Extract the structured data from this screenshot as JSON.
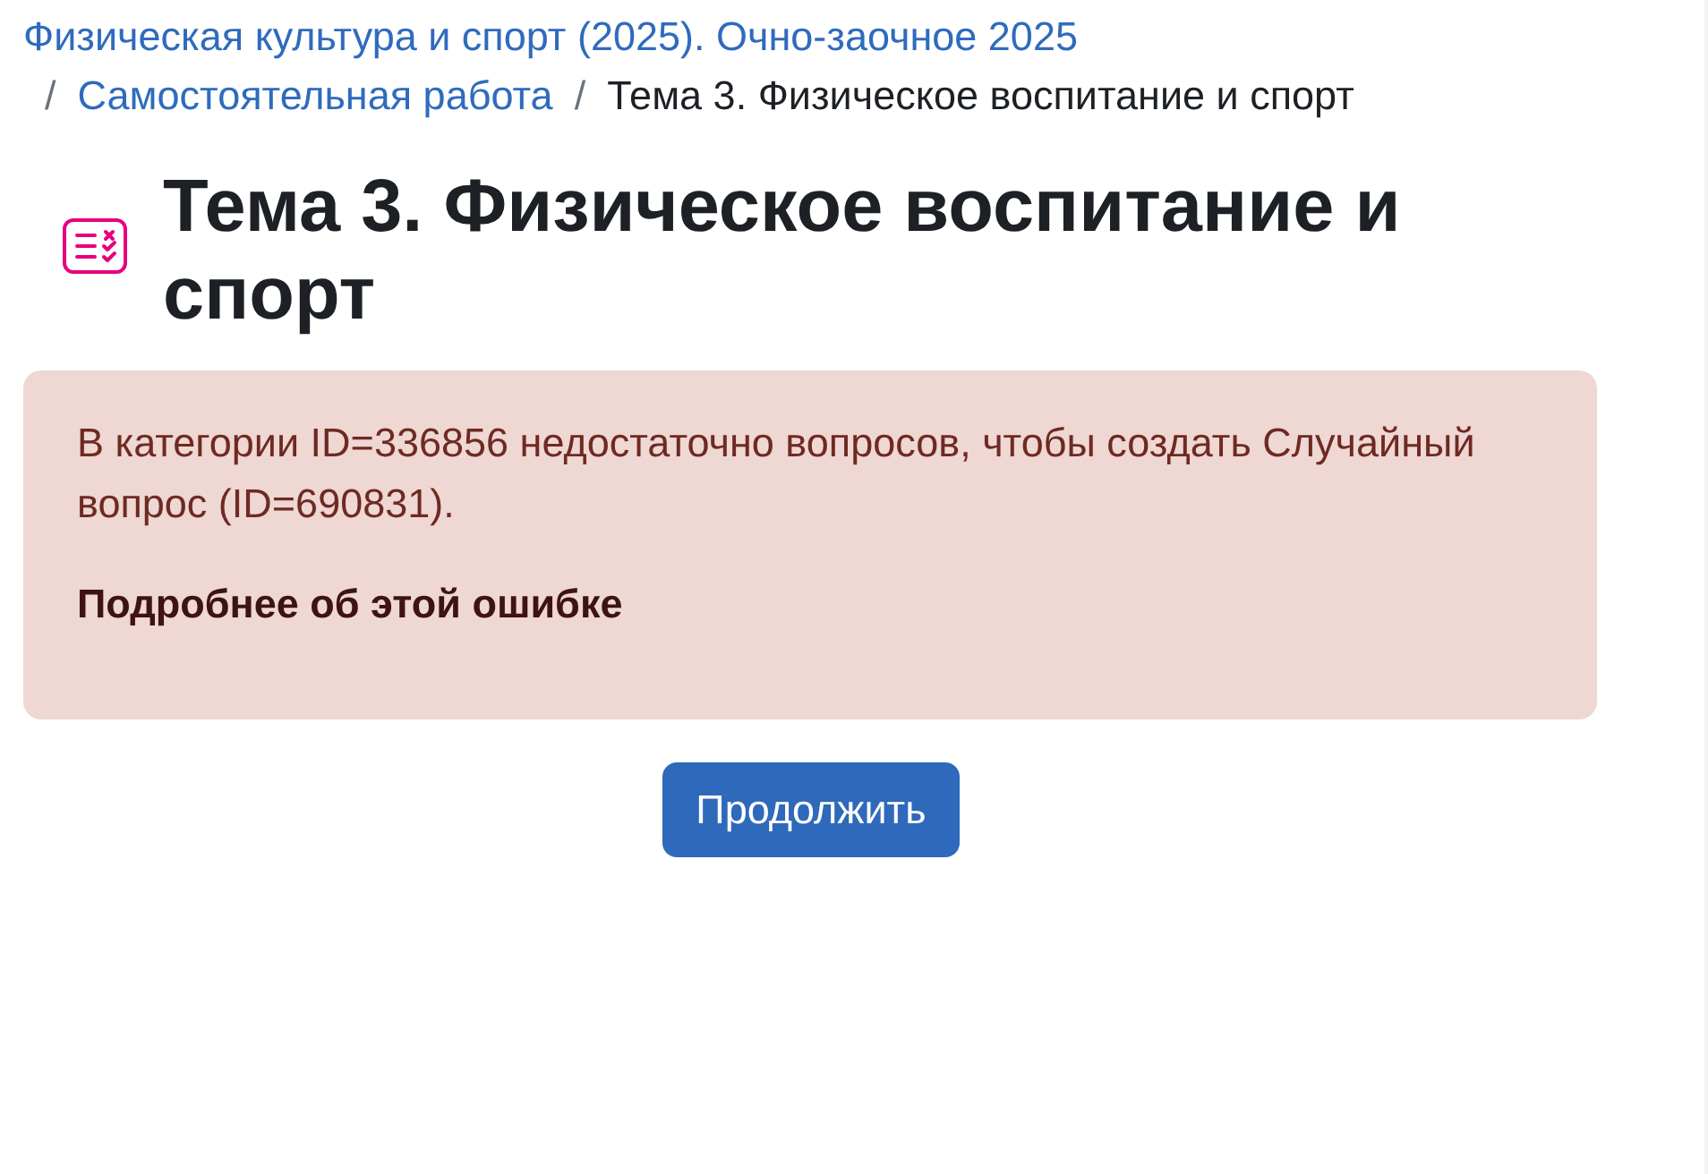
{
  "breadcrumb": [
    {
      "kind": "link",
      "label": "Физическая культура и спорт (2025). Очно-заочное 2025"
    },
    {
      "kind": "link",
      "separator": "/",
      "label": "Самостоятельная работа"
    },
    {
      "kind": "current",
      "separator": "/",
      "label": "Тема 3. Физическое воспитание и спорт"
    }
  ],
  "page": {
    "title": "Тема 3. Физическое воспитание и спорт"
  },
  "alert": {
    "message": "В категории ID=336856 недостаточно вопросов, чтобы создать Случайный вопрос (ID=690831).",
    "details_link": "Подробнее об этой ошибке"
  },
  "buttons": [
    {
      "label": "Продолжить"
    }
  ]
}
